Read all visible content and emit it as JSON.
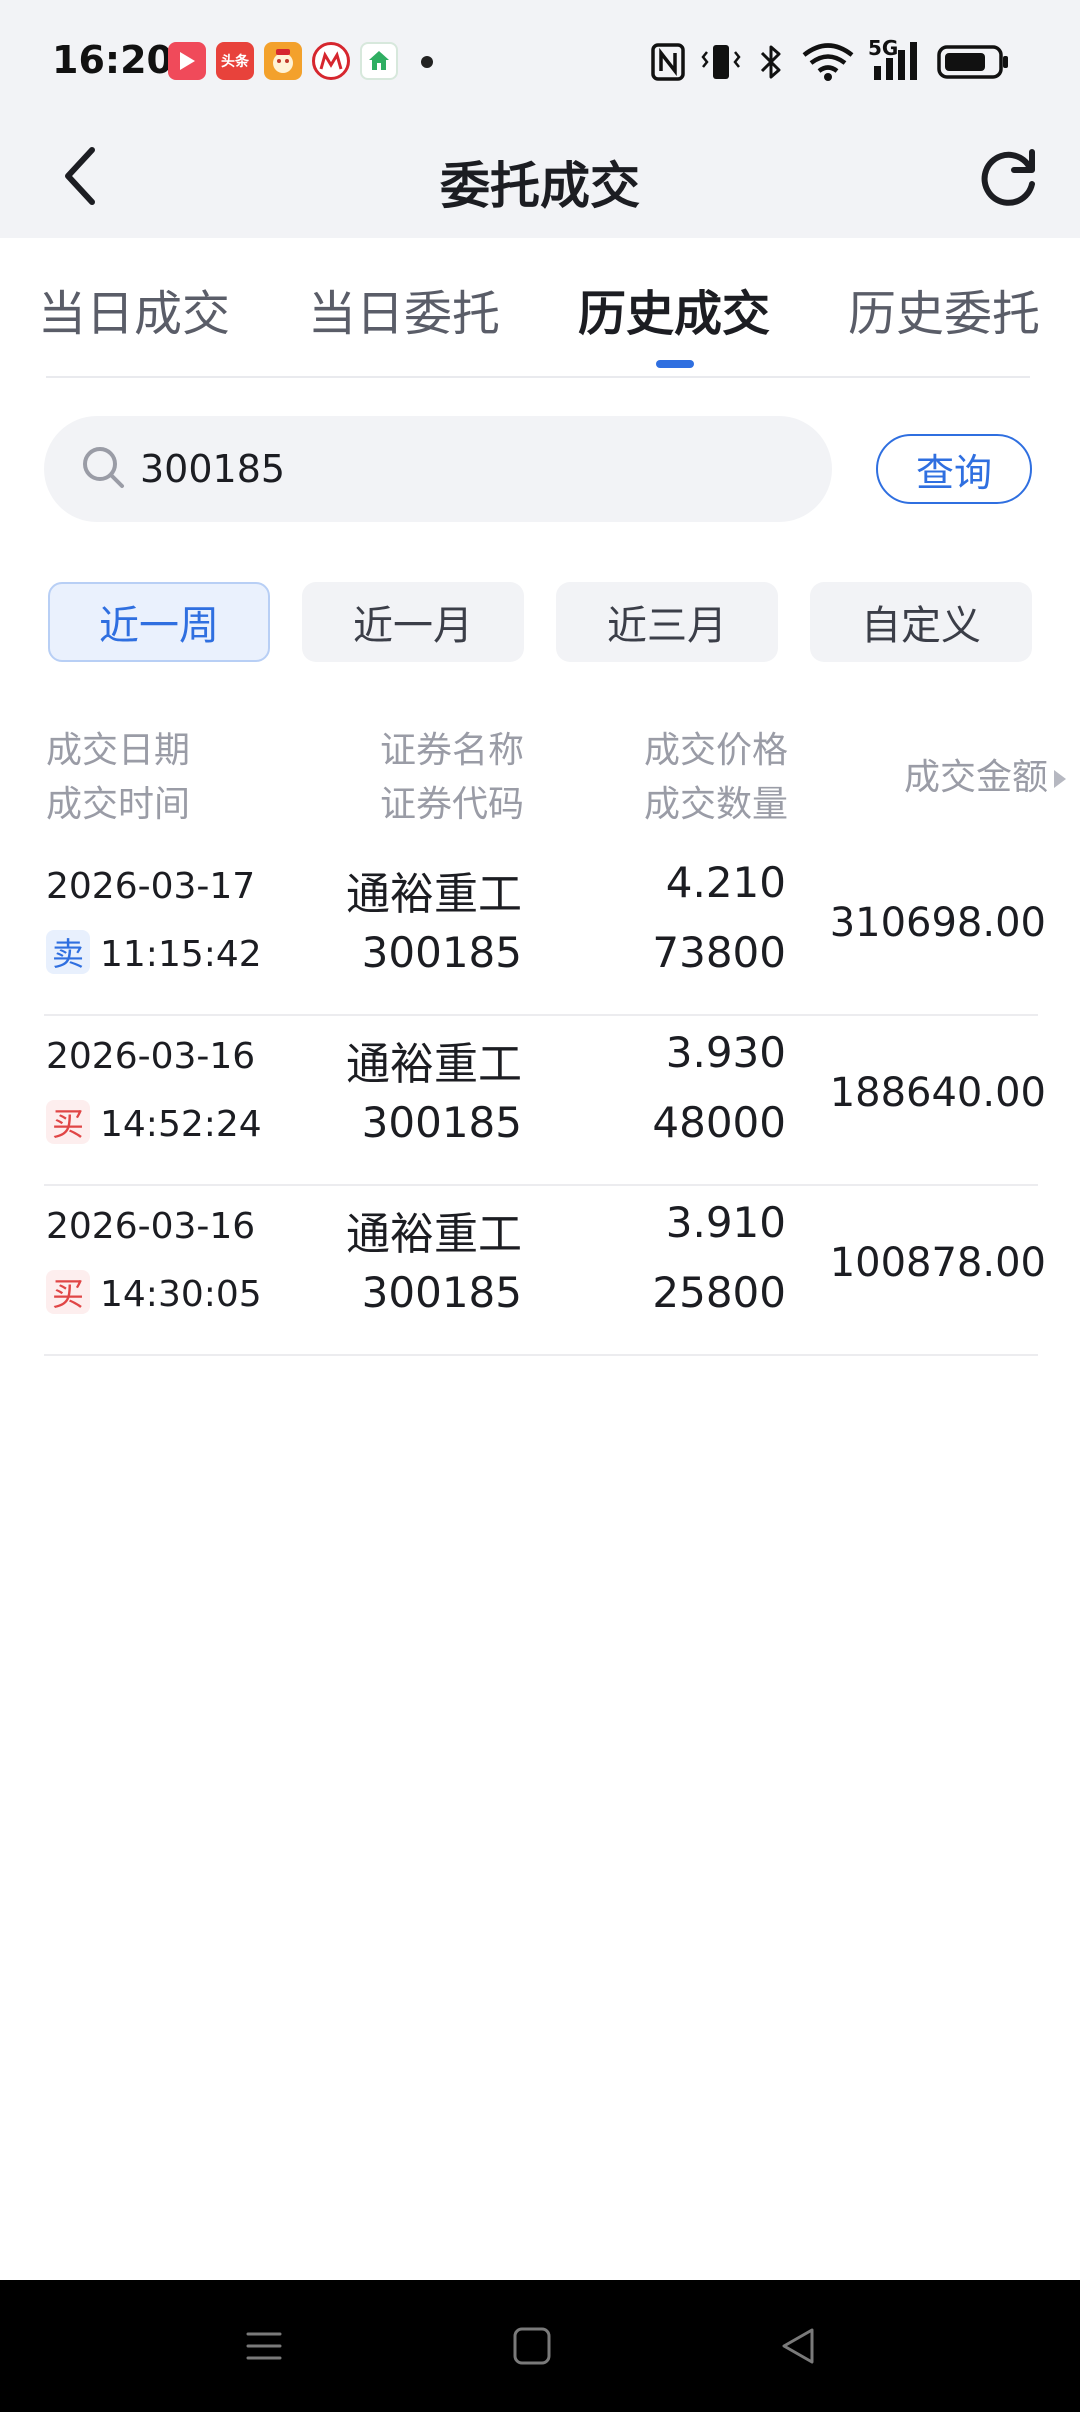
{
  "status_bar": {
    "time": "16:20",
    "apps": [
      {
        "icon": "video-app-icon",
        "color": "#f04a5a"
      },
      {
        "icon": "toutiao-app-icon",
        "label": "头条",
        "color": "#e8423b"
      },
      {
        "icon": "game-app-icon",
        "color": "#f3a12c"
      },
      {
        "icon": "cmb-bank-app-icon",
        "color": "#d6262e"
      },
      {
        "icon": "home-app-icon",
        "color": "#2fae62"
      }
    ],
    "network": "5G",
    "icons": [
      "nfc-icon",
      "vibrate-icon",
      "bluetooth-icon",
      "wifi-icon",
      "cellular-signal-icon",
      "battery-icon"
    ]
  },
  "header": {
    "title": "委托成交"
  },
  "tabs": [
    {
      "label": "当日成交",
      "active": false
    },
    {
      "label": "当日委托",
      "active": false
    },
    {
      "label": "历史成交",
      "active": true
    },
    {
      "label": "历史委托",
      "active": false
    }
  ],
  "search": {
    "value": "300185",
    "button_label": "查询"
  },
  "periods": [
    {
      "label": "近一周",
      "active": true
    },
    {
      "label": "近一月",
      "active": false
    },
    {
      "label": "近三月",
      "active": false
    },
    {
      "label": "自定义",
      "active": false
    }
  ],
  "table_header": {
    "col1_line1": "成交日期",
    "col1_line2": "成交时间",
    "col2_line1": "证券名称",
    "col2_line2": "证券代码",
    "col3_line1": "成交价格",
    "col3_line2": "成交数量",
    "col4": "成交金额"
  },
  "rows": [
    {
      "date": "2026-03-17",
      "side": "卖",
      "side_type": "sell",
      "time": "11:15:42",
      "name": "通裕重工",
      "code": "300185",
      "price": "4.210",
      "qty": "73800",
      "amount": "310698.00"
    },
    {
      "date": "2026-03-16",
      "side": "买",
      "side_type": "buy",
      "time": "14:52:24",
      "name": "通裕重工",
      "code": "300185",
      "price": "3.930",
      "qty": "48000",
      "amount": "188640.00"
    },
    {
      "date": "2026-03-16",
      "side": "买",
      "side_type": "buy",
      "time": "14:30:05",
      "name": "通裕重工",
      "code": "300185",
      "price": "3.910",
      "qty": "25800",
      "amount": "100878.00"
    }
  ],
  "colors": {
    "accent": "#2f6fe0",
    "sell": "#2f6fe0",
    "buy": "#e04646",
    "header_bg": "#f2f3f6"
  }
}
